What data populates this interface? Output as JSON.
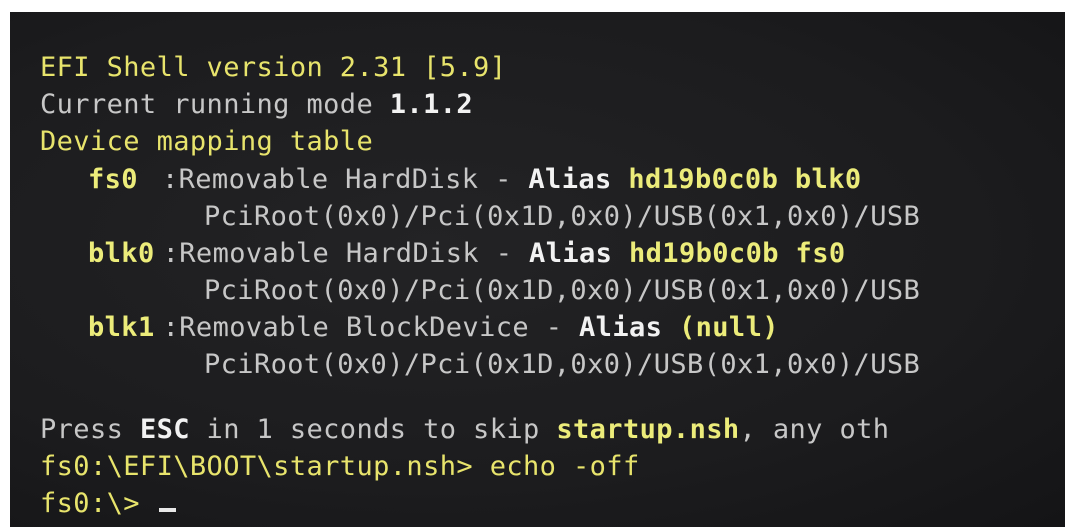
{
  "shell": {
    "title": "EFI Shell version 2.31 [5.9]",
    "mode_prefix": "Current running mode ",
    "mode_value": "1.1.2",
    "table_header": "Device mapping table",
    "mappings": [
      {
        "name": "fs0",
        "desc": ":Removable HardDisk - ",
        "alias_label": "Alias ",
        "alias_value": "hd19b0c0b blk0",
        "path": "PciRoot(0x0)/Pci(0x1D,0x0)/USB(0x1,0x0)/USB"
      },
      {
        "name": "blk0",
        "desc": ":Removable HardDisk - ",
        "alias_label": "Alias ",
        "alias_value": "hd19b0c0b fs0",
        "path": "PciRoot(0x0)/Pci(0x1D,0x0)/USB(0x1,0x0)/USB"
      },
      {
        "name": "blk1",
        "desc": ":Removable BlockDevice - ",
        "alias_label": "Alias ",
        "alias_value": "(null)",
        "path": "PciRoot(0x0)/Pci(0x1D,0x0)/USB(0x1,0x0)/USB"
      }
    ],
    "press_prefix": "Press ",
    "press_key": "ESC",
    "press_mid": " in 1 seconds to skip ",
    "press_file": "startup.nsh",
    "press_suffix": ", any oth",
    "command_line": "fs0:\\EFI\\BOOT\\startup.nsh> echo -off",
    "prompt": "fs0:\\> "
  },
  "colors": {
    "background": "#1c1c1e",
    "yellow_text": "#e8e46c",
    "gray_text": "#c7c7c7",
    "bold_white": "#f2f2f2"
  }
}
